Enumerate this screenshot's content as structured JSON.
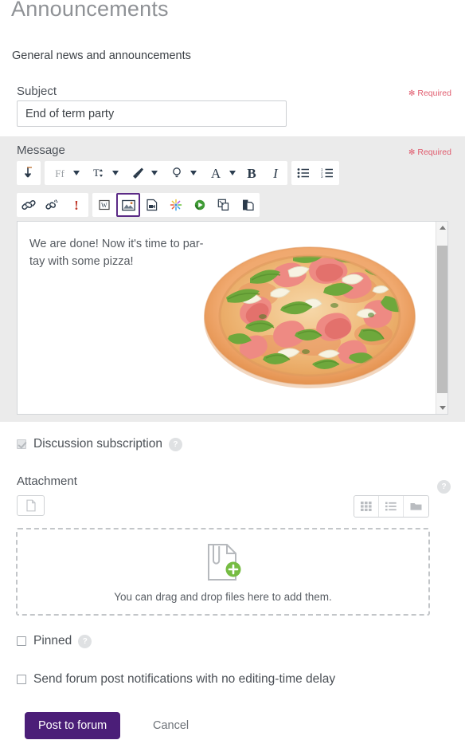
{
  "page": {
    "title": "Announcements",
    "intro": "General news and announcements"
  },
  "subject": {
    "label": "Subject",
    "value": "End of term party",
    "required_star": "✻",
    "required_label": "Required"
  },
  "message": {
    "label": "Message",
    "required_star": "✻",
    "required_label": "Required",
    "body_text": "We are done!  Now it's time to par-tay with some pizza!",
    "image_alt": "pizza-photo",
    "toolbar_row1": [
      {
        "name": "expand-toolbar-icon",
        "glyph": "⤵",
        "caret": false
      },
      {
        "name": "font-family-icon",
        "glyph": "Ff",
        "caret": true
      },
      {
        "name": "font-size-icon",
        "glyph": "T",
        "caret": true
      },
      {
        "name": "highlight-brush-icon",
        "glyph": "brush",
        "caret": true
      },
      {
        "name": "accessibility-bulb-icon",
        "glyph": "bulb",
        "caret": true
      },
      {
        "name": "text-color-icon",
        "glyph": "A",
        "caret": true
      },
      {
        "name": "bold-icon",
        "glyph": "B",
        "caret": false
      },
      {
        "name": "italic-icon",
        "glyph": "I",
        "caret": false
      },
      {
        "name": "bullet-list-icon",
        "glyph": "ul",
        "caret": false
      },
      {
        "name": "numbered-list-icon",
        "glyph": "ol",
        "caret": false
      }
    ],
    "toolbar_row2": [
      {
        "name": "insert-link-icon"
      },
      {
        "name": "unlink-icon"
      },
      {
        "name": "special-character-icon"
      },
      {
        "name": "import-word-icon"
      },
      {
        "name": "insert-image-icon",
        "selected": true
      },
      {
        "name": "insert-media-icon"
      },
      {
        "name": "h5p-icon"
      },
      {
        "name": "record-audio-icon"
      },
      {
        "name": "copy-icon"
      },
      {
        "name": "paste-icon"
      }
    ]
  },
  "discussion_subscription": {
    "label": "Discussion subscription",
    "checked": true,
    "disabled": true,
    "help_glyph": "?"
  },
  "attachment": {
    "label": "Attachment",
    "filepicker_icon": "file-icon",
    "help_glyph": "?",
    "views": [
      {
        "name": "grid-view-icon"
      },
      {
        "name": "list-view-icon"
      },
      {
        "name": "tree-view-icon"
      }
    ],
    "dropzone_text": "You can drag and drop files here to add them."
  },
  "pinned": {
    "label": "Pinned",
    "checked": false,
    "help_glyph": "?"
  },
  "notify": {
    "label": "Send forum post notifications with no editing-time delay",
    "checked": false
  },
  "actions": {
    "post_label": "Post to forum",
    "cancel_label": "Cancel"
  },
  "colors": {
    "accent_purple": "#4b1e78",
    "required_red": "#e05c6e",
    "panel_gray": "#ebebeb"
  }
}
